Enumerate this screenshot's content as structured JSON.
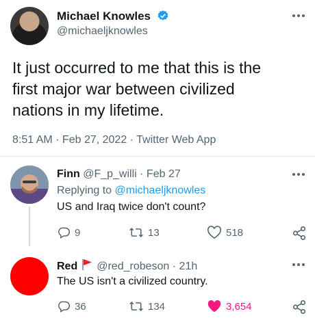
{
  "tweet": {
    "display_name": "Michael Knowles",
    "handle": "@michaeljknowles",
    "text_line1": "It just occurred to me that this is the",
    "text_line2": "first major war between civilized",
    "text_line3": "nations in my lifetime.",
    "meta": "8:51 AM · Feb 27, 2022 · Twitter Web App"
  },
  "reply1": {
    "name": "Finn",
    "handle_date": "@F_p_willi · Feb 27",
    "replying_prefix": "Replying to ",
    "replying_handle": "@michaeljknowles",
    "text": "US and Iraq twice don't count?",
    "comments": "9",
    "retweets": "13",
    "likes": "518"
  },
  "reply2": {
    "name": "Red",
    "handle_date": "@red_robeson · 21h",
    "text": "The US isn't a civilized country.",
    "comments": "36",
    "retweets": "134",
    "likes": "3,654"
  },
  "colors": {
    "blue": "#1d9bf0",
    "like_pink": "#f91880",
    "red_avatar": "#ff0000",
    "muted": "#536471"
  },
  "icons": [
    "verified-badge-icon",
    "more-options-icon",
    "reply-icon",
    "retweet-icon",
    "like-icon",
    "share-icon",
    "red-flag-icon"
  ]
}
